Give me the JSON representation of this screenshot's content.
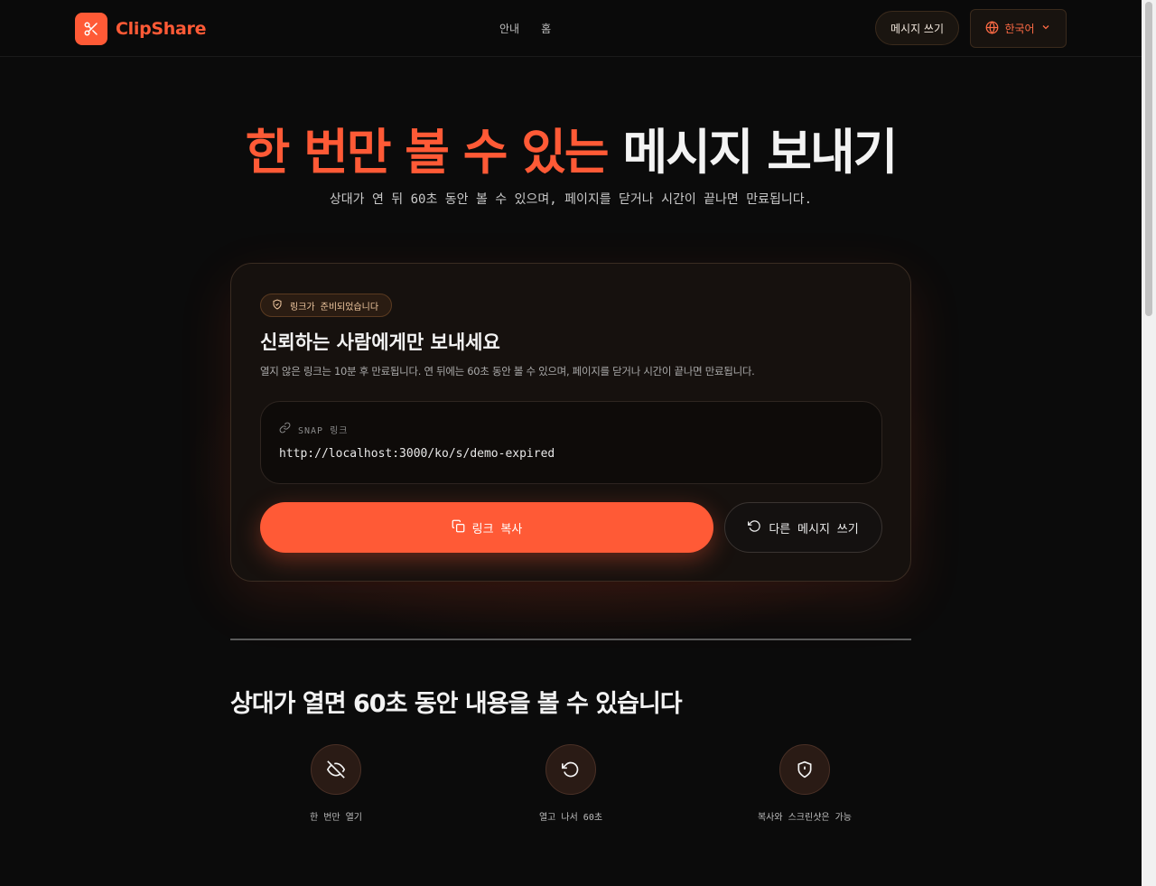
{
  "brand": {
    "name": "ClipShare",
    "accent": "#ff5a36"
  },
  "nav": {
    "items": [
      "안내",
      "홈"
    ]
  },
  "header": {
    "write_button": "메시지 쓰기",
    "language": "한국어"
  },
  "hero": {
    "title_accent": "한 번만 볼 수 있는",
    "title_plain": "메시지 보내기",
    "subtitle": "상대가 연 뒤 60초 동안 볼 수 있으며, 페이지를 닫거나 시간이 끝나면 만료됩니다."
  },
  "card": {
    "badge": "링크가 준비되었습니다",
    "title": "신뢰하는 사람에게만 보내세요",
    "description": "열지 않은 링크는 10분 후 만료됩니다. 연 뒤에는 60초 동안 볼 수 있으며, 페이지를 닫거나 시간이 끝나면 만료됩니다.",
    "link_label": "SNAP 링크",
    "link_url": "http://localhost:3000/ko/s/demo-expired",
    "copy_button": "링크 복사",
    "new_button": "다른 메시지 쓰기"
  },
  "section": {
    "title": "상대가 열면 60초 동안 내용을 볼 수 있습니다",
    "features": [
      {
        "label": "한 번만 열기",
        "icon": "eye-off-icon"
      },
      {
        "label": "열고 나서 60초",
        "icon": "rotate-ccw-icon"
      },
      {
        "label": "복사와 스크린샷은 가능",
        "icon": "shield-alert-icon"
      }
    ]
  }
}
